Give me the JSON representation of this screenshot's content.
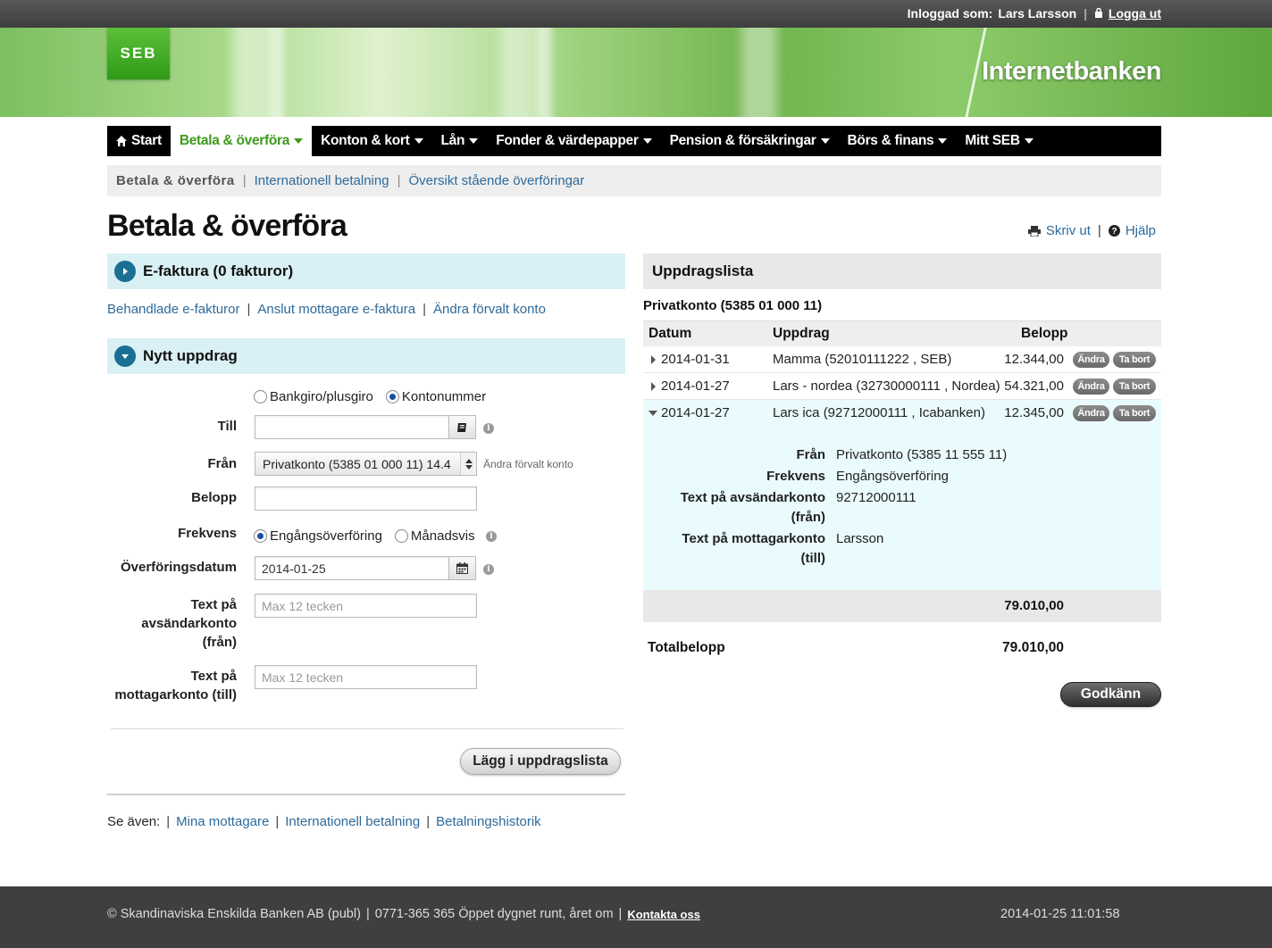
{
  "topbar": {
    "logged_in_label": "Inloggad som:",
    "user_name": "Lars Larsson",
    "logout_label": "Logga ut"
  },
  "header": {
    "logo_text": "SEB",
    "title": "Internetbanken"
  },
  "main_nav": [
    {
      "label": "Start",
      "icon": "home-icon"
    },
    {
      "label": "Betala & överföra",
      "active": true
    },
    {
      "label": "Konton & kort"
    },
    {
      "label": "Lån"
    },
    {
      "label": "Fonder & värdepapper"
    },
    {
      "label": "Pension & försäkringar"
    },
    {
      "label": "Börs & finans"
    },
    {
      "label": "Mitt SEB"
    }
  ],
  "sub_nav": {
    "current": "Betala & överföra",
    "links": [
      "Internationell betalning",
      "Översikt stående överföringar"
    ]
  },
  "page": {
    "title": "Betala & överföra",
    "print_label": "Skriv ut",
    "help_label": "Hjälp"
  },
  "efaktura": {
    "heading": "E-faktura (0 fakturor)",
    "links": [
      "Behandlade e-fakturor",
      "Anslut mottagare e-faktura",
      "Ändra förvalt konto"
    ]
  },
  "new_order": {
    "heading": "Nytt uppdrag",
    "type_options": [
      "Bankgiro/plusgiro",
      "Kontonummer"
    ],
    "selected_type": "Kontonummer",
    "labels": {
      "to": "Till",
      "from": "Från",
      "amount": "Belopp",
      "frequency": "Frekvens",
      "date": "Överföringsdatum",
      "sender_text_1": "Text på",
      "sender_text_2": "avsändarkonto",
      "sender_text_3": "(från)",
      "receiver_text_1": "Text på",
      "receiver_text_2": "mottagarkonto (till)"
    },
    "to_value": "",
    "from_value": "Privatkonto (5385 01 000 11) 14.4",
    "from_hint": "Ändra förvalt konto",
    "amount_value": "",
    "frequency_options": [
      "Engångsöverföring",
      "Månadsvis"
    ],
    "selected_frequency": "Engångsöverföring",
    "date_value": "2014-01-25",
    "text_placeholder": "Max 12 tecken",
    "submit_label": "Lägg i uppdragslista"
  },
  "see_also": {
    "label": "Se även:",
    "links": [
      "Mina mottagare",
      "Internationell betalning",
      "Betalningshistorik"
    ]
  },
  "order_list": {
    "heading": "Uppdragslista",
    "account": "Privatkonto (5385 01 000 11)",
    "columns": [
      "Datum",
      "Uppdrag",
      "Belopp"
    ],
    "edit_label": "Ändra",
    "delete_label": "Ta bort",
    "rows": [
      {
        "date": "2014-01-31",
        "description": "Mamma (52010111222 , SEB)",
        "amount": "12.344,00",
        "expanded": false
      },
      {
        "date": "2014-01-27",
        "description": "Lars - nordea (32730000111 , Nordea)",
        "amount": "54.321,00",
        "expanded": false
      },
      {
        "date": "2014-01-27",
        "description": "Lars ica (92712000111 , Icabanken)",
        "amount": "12.345,00",
        "expanded": true
      }
    ],
    "details": {
      "from_label": "Från",
      "from_value": "Privatkonto (5385 11 555 11)",
      "frequency_label": "Frekvens",
      "frequency_value": "Engångsöverföring",
      "sender_text_label_1": "Text på avsändarkonto",
      "sender_text_label_2": "(från)",
      "sender_text_value": "92712000111",
      "receiver_text_label_1": "Text på mottagarkonto",
      "receiver_text_label_2": "(till)",
      "receiver_text_value": "Larsson"
    },
    "subtotal": "79.010,00",
    "total_label": "Totalbelopp",
    "total": "79.010,00",
    "approve_label": "Godkänn"
  },
  "footer": {
    "copyright": "© Skandinaviska Enskilda Banken AB (publ)",
    "phone": "0771-365 365 Öppet dygnet runt, året om",
    "contact_label": "Kontakta oss",
    "timestamp": "2014-01-25 11:01:58"
  },
  "colors": {
    "accent_green": "#3e9a1c",
    "link_blue": "#2e6a9a",
    "panel_cyan": "#d9f0f5",
    "nav_black": "#000000"
  }
}
